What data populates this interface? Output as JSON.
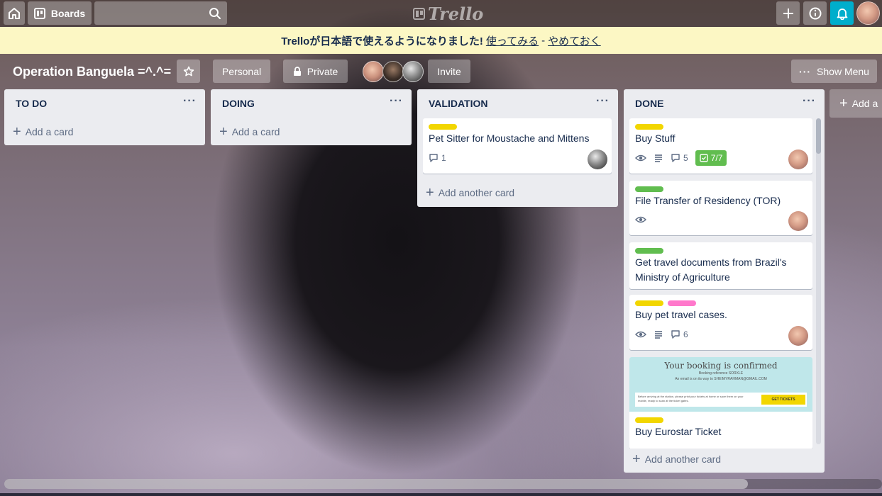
{
  "topbar": {
    "boards_label": "Boards",
    "logo_text": "Trello",
    "bell_color": "#00aecc"
  },
  "banner": {
    "message": "Trelloが日本語で使えるようになりました!",
    "try_link": "使ってみる",
    "separator": "-",
    "dismiss_link": "やめておく",
    "background": "#fcf7c4"
  },
  "board": {
    "title": "Operation Banguela =^.^=",
    "team_label": "Personal",
    "visibility_label": "Private",
    "invite_label": "Invite",
    "menu_label": "Show Menu"
  },
  "lists": [
    {
      "title": "TO DO",
      "add_label": "Add a card",
      "cards": []
    },
    {
      "title": "DOING",
      "add_label": "Add a card",
      "cards": []
    },
    {
      "title": "VALIDATION",
      "add_label": "Add another card",
      "cards": [
        {
          "labels": [
            "yellow"
          ],
          "title": "Pet Sitter for Moustache and Mittens",
          "comments": "1"
        }
      ]
    },
    {
      "title": "DONE",
      "add_label": "Add another card",
      "cards": [
        {
          "labels": [
            "yellow"
          ],
          "title": "Buy Stuff",
          "comments": "5",
          "checklist": "7/7"
        },
        {
          "labels": [
            "green"
          ],
          "title": "File Transfer of Residency (TOR)"
        },
        {
          "labels": [
            "green"
          ],
          "title": "Get travel documents from Brazil's Ministry of Agriculture"
        },
        {
          "labels": [
            "yellow",
            "pink"
          ],
          "title": "Buy pet travel cases.",
          "comments": "6"
        },
        {
          "labels": [
            "yellow"
          ],
          "title": "Buy Eurostar Ticket",
          "cover": {
            "heading": "Your booking is confirmed",
            "reference": "Booking reference SORXLE",
            "email": "An email is on its way to SHEIMYRAHMAN@GMAIL.COM",
            "note": "Before arriving at the station, please print your tickets at home or save them on your mobile, ready to scan at the ticket gates.",
            "button": "GET TICKETS"
          }
        }
      ]
    }
  ],
  "add_list_label": "Add a",
  "colors": {
    "list_bg": "#ebecf0",
    "label_yellow": "#f2d600",
    "label_green": "#61bd4f",
    "label_pink": "#ff78cb"
  }
}
